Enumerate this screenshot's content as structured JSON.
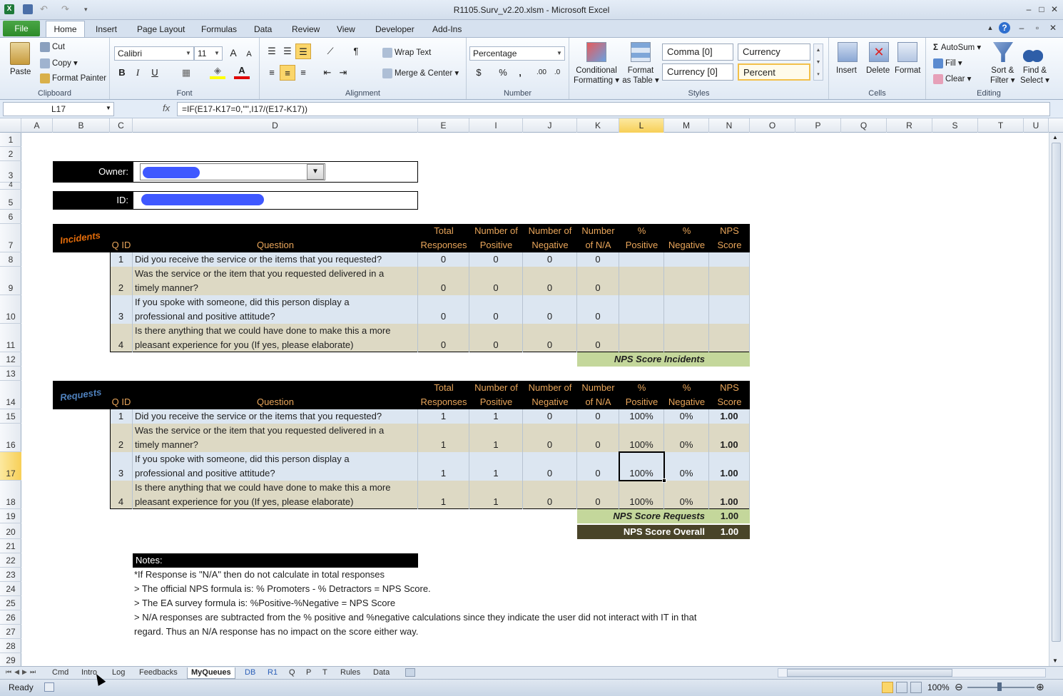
{
  "window": {
    "title": "R1105.Surv_v2.20.xlsm  -  Microsoft Excel"
  },
  "ribbon_tabs": [
    "File",
    "Home",
    "Insert",
    "Page Layout",
    "Formulas",
    "Data",
    "Review",
    "View",
    "Developer",
    "Add-Ins"
  ],
  "clipboard": {
    "paste": "Paste",
    "cut": "Cut",
    "copy": "Copy",
    "format_painter": "Format Painter",
    "label": "Clipboard"
  },
  "font": {
    "name": "Calibri",
    "size": "11",
    "label": "Font",
    "bold": "B",
    "italic": "I",
    "underline": "U",
    "grow": "A",
    "shrink": "A"
  },
  "alignment": {
    "wrap_text": "Wrap Text",
    "merge_center": "Merge & Center",
    "label": "Alignment"
  },
  "number": {
    "format": "Percentage",
    "label": "Number",
    "currency": "$",
    "percent": "%",
    "comma": ","
  },
  "styles": {
    "conditional": "Conditional",
    "formatting": "Formatting",
    "format": "Format",
    "as_table": "as Table",
    "comma0": "Comma [0]",
    "currency": "Currency",
    "currency0": "Currency [0]",
    "percent": "Percent",
    "label": "Styles"
  },
  "cells": {
    "insert": "Insert",
    "delete": "Delete",
    "format": "Format",
    "label": "Cells"
  },
  "editing": {
    "autosum": "AutoSum",
    "fill": "Fill",
    "clear": "Clear",
    "sort": "Sort &",
    "filter": "Filter",
    "find": "Find &",
    "select": "Select",
    "label": "Editing"
  },
  "formula_bar": {
    "name_box": "L17",
    "fx": "fx",
    "formula": "=IF(E17-K17=0,\"\",I17/(E17-K17))"
  },
  "columns": [
    "A",
    "B",
    "C",
    "D",
    "E",
    "I",
    "J",
    "K",
    "L",
    "M",
    "N",
    "O",
    "P",
    "Q",
    "R",
    "S",
    "T",
    "U"
  ],
  "rows": [
    "1",
    "2",
    "3",
    "4",
    "5",
    "6",
    "7",
    "8",
    "9",
    "10",
    "11",
    "12",
    "13",
    "14",
    "15",
    "16",
    "17",
    "18",
    "19",
    "20",
    "21",
    "22",
    "23",
    "24",
    "25",
    "26",
    "27",
    "28",
    "29"
  ],
  "form": {
    "owner_label": "Owner:",
    "id_label": "ID:"
  },
  "table_headers": {
    "qid": "Q ID",
    "question": "Question",
    "total1": "Total",
    "total2": "Responses",
    "pos1": "Number of",
    "pos2": "Positive",
    "neg1": "Number of",
    "neg2": "Negative",
    "na1": "Number",
    "na2": "of N/A",
    "ppos1": "%",
    "ppos2": "Positive",
    "pneg1": "%",
    "pneg2": "Negative",
    "nps1": "NPS",
    "nps2": "Score"
  },
  "incidents": {
    "label": "Incidents",
    "rows": [
      {
        "id": "1",
        "q1": "Did you receive the service or the items that you requested?",
        "q2": "",
        "total": "0",
        "pos": "0",
        "neg": "0",
        "na": "0",
        "ppos": "",
        "pneg": "",
        "nps": ""
      },
      {
        "id": "2",
        "q1": "Was the service or the item that you requested delivered in a",
        "q2": "timely manner?",
        "total": "0",
        "pos": "0",
        "neg": "0",
        "na": "0",
        "ppos": "",
        "pneg": "",
        "nps": ""
      },
      {
        "id": "3",
        "q1": "If you spoke with someone, did this person display a",
        "q2": "professional and positive attitude?",
        "total": "0",
        "pos": "0",
        "neg": "0",
        "na": "0",
        "ppos": "",
        "pneg": "",
        "nps": ""
      },
      {
        "id": "4",
        "q1": "Is there anything that we could have done to make this a more",
        "q2": "pleasant experience for you (If yes, please elaborate)",
        "total": "0",
        "pos": "0",
        "neg": "0",
        "na": "0",
        "ppos": "",
        "pneg": "",
        "nps": ""
      }
    ],
    "score_label": "NPS Score Incidents",
    "score": ""
  },
  "requests": {
    "label": "Requests",
    "rows": [
      {
        "id": "1",
        "q1": "Did you receive the service or the items that you requested?",
        "q2": "",
        "total": "1",
        "pos": "1",
        "neg": "0",
        "na": "0",
        "ppos": "100%",
        "pneg": "0%",
        "nps": "1.00"
      },
      {
        "id": "2",
        "q1": "Was the service or the item that you requested delivered in a",
        "q2": "timely manner?",
        "total": "1",
        "pos": "1",
        "neg": "0",
        "na": "0",
        "ppos": "100%",
        "pneg": "0%",
        "nps": "1.00"
      },
      {
        "id": "3",
        "q1": "If you spoke with someone, did this person display a",
        "q2": "professional and positive attitude?",
        "total": "1",
        "pos": "1",
        "neg": "0",
        "na": "0",
        "ppos": "100%",
        "pneg": "0%",
        "nps": "1.00"
      },
      {
        "id": "4",
        "q1": "Is there anything that we could have done to make this a more",
        "q2": "pleasant experience for you (If yes, please elaborate)",
        "total": "1",
        "pos": "1",
        "neg": "0",
        "na": "0",
        "ppos": "100%",
        "pneg": "0%",
        "nps": "1.00"
      }
    ],
    "score_label": "NPS Score Requests",
    "score": "1.00",
    "overall_label": "NPS Score Overall",
    "overall": "1.00"
  },
  "notes": {
    "title": "Notes:",
    "lines": [
      "*If Response is \"N/A\" then do not calculate in total responses",
      "> The official NPS formula is: % Promoters - % Detractors = NPS Score.",
      "> The EA survey formula is: %Positive-%Negative = NPS Score",
      "> N/A responses are subtracted from the % positive and %negative calculations since they indicate the user did not interact with IT in that",
      "regard. Thus an N/A response has no impact on the score either way."
    ]
  },
  "sheet_tabs": [
    "Cmd",
    "Intro",
    "Log",
    "Feedbacks",
    "MyQueues",
    "DB",
    "R1",
    "Q",
    "P",
    "T",
    "Rules",
    "Data"
  ],
  "active_sheet": "MyQueues",
  "status": {
    "ready": "Ready",
    "zoom": "100%"
  },
  "colors": {
    "header_orange": "#e8a55a",
    "incidents_label": "#e46c0a",
    "requests_label": "#4f81bd",
    "row_blue": "#dce6f1",
    "row_tan": "#ddd9c4",
    "score_green": "#c4d79b",
    "overall_olive": "#494429"
  }
}
